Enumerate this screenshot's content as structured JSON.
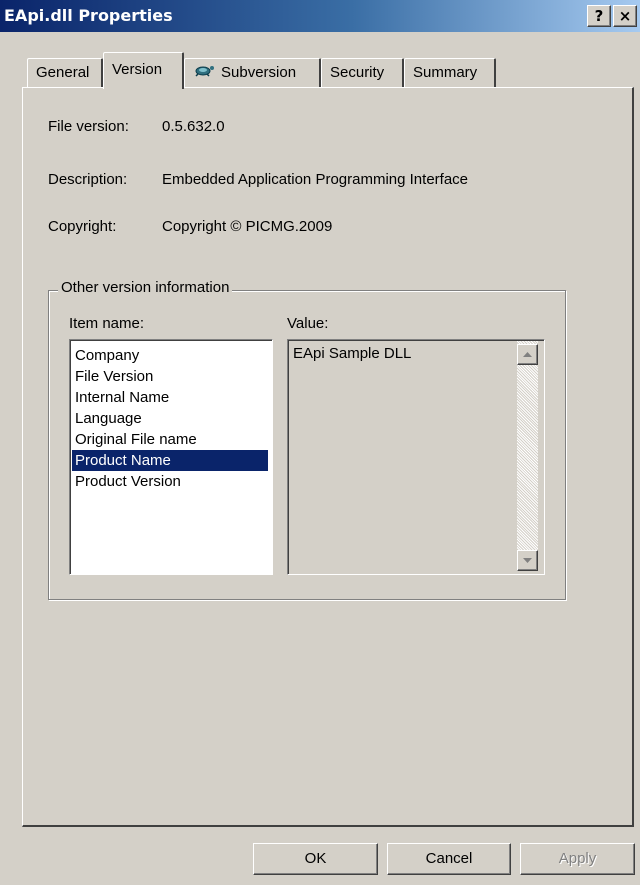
{
  "window": {
    "title": "EApi.dll Properties",
    "help_button": "?",
    "close_button": "×"
  },
  "tabs": [
    {
      "label": "General",
      "active": false
    },
    {
      "label": "Version",
      "active": true
    },
    {
      "label": "Subversion",
      "active": false,
      "icon": "turtle-icon"
    },
    {
      "label": "Security",
      "active": false
    },
    {
      "label": "Summary",
      "active": false
    }
  ],
  "version": {
    "file_version_label": "File version:",
    "file_version_value": "0.5.632.0",
    "description_label": "Description:",
    "description_value": "Embedded Application Programming Interface",
    "copyright_label": "Copyright:",
    "copyright_value": "Copyright © PICMG.2009"
  },
  "other_info": {
    "group_title": "Other version information",
    "item_name_label": "Item name:",
    "value_label": "Value:",
    "items": [
      "Company",
      "File Version",
      "Internal Name",
      "Language",
      "Original File name",
      "Product Name",
      "Product Version"
    ],
    "selected_item": "Product Name",
    "value_text": "EApi Sample DLL"
  },
  "buttons": {
    "ok": "OK",
    "cancel": "Cancel",
    "apply": "Apply"
  },
  "colors": {
    "titlebar_start": "#0a246a",
    "titlebar_end": "#a6caf0",
    "dialog_face": "#d4d0c8",
    "selection": "#0a246a"
  }
}
